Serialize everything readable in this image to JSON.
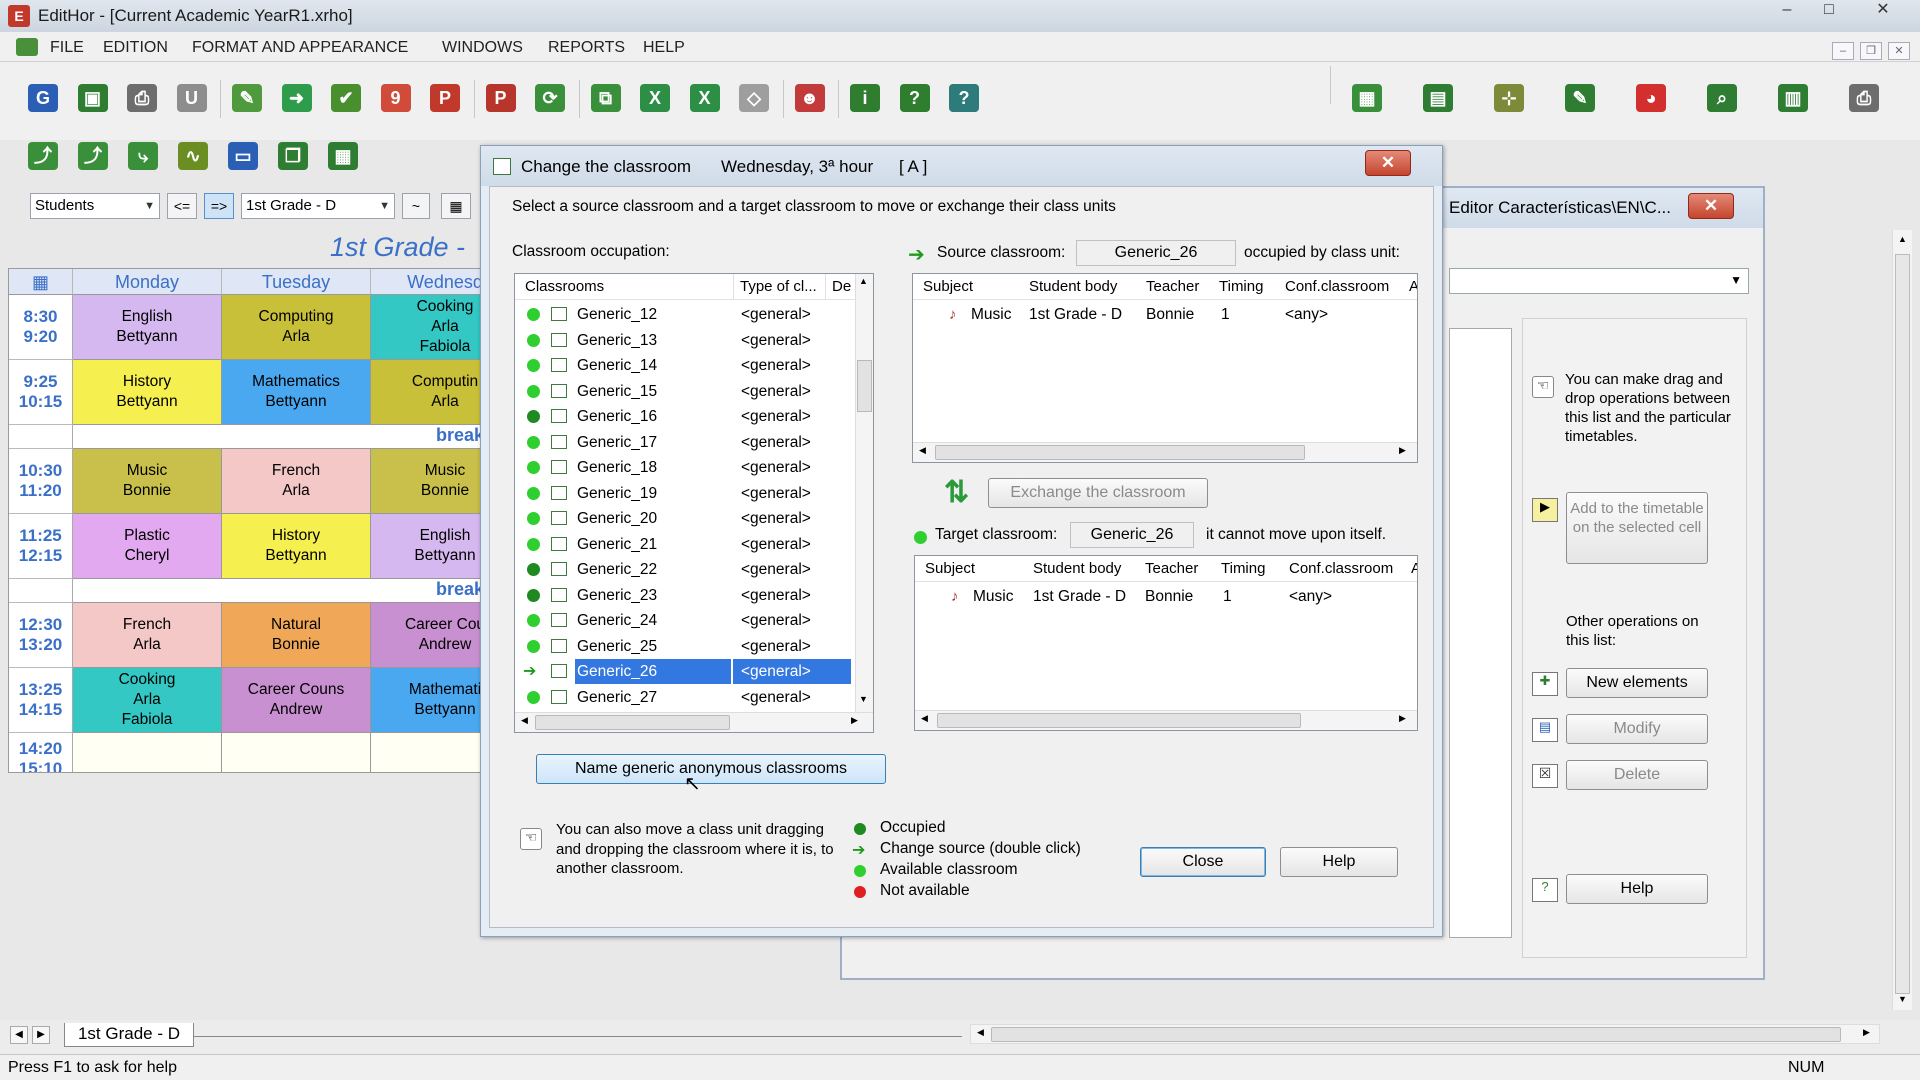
{
  "app": {
    "title": "EditHor - [Current Academic YearR1.xrho]",
    "window_controls": [
      "–",
      "□",
      "✕"
    ]
  },
  "menu": [
    "FILE",
    "EDITION",
    "FORMAT AND APPEARANCE",
    "WINDOWS",
    "REPORTS",
    "HELP"
  ],
  "toolbar": {
    "icons_row1": [
      {
        "name": "ghc-icon",
        "color": "#2a5fb5",
        "glyph": "G"
      },
      {
        "name": "save-icon",
        "color": "#2e7d32",
        "glyph": "▣"
      },
      {
        "name": "print-icon",
        "color": "#6d6d6d",
        "glyph": "⎙"
      },
      {
        "name": "attach-icon",
        "color": "#8d8d8d",
        "glyph": "U"
      },
      {
        "name": "chart-edit-icon",
        "color": "#4f9a3c",
        "glyph": "✎"
      },
      {
        "name": "export-icon",
        "color": "#2e9c4a",
        "glyph": "➜"
      },
      {
        "name": "check-icon",
        "color": "#4a8f2e",
        "glyph": "✔"
      },
      {
        "name": "calendar-icon",
        "color": "#d14b3b",
        "glyph": "9"
      },
      {
        "name": "pdf-icon",
        "color": "#c0392b",
        "glyph": "P"
      },
      {
        "name": "pdf2-icon",
        "color": "#b7352a",
        "glyph": "P"
      },
      {
        "name": "refresh-icon",
        "color": "#3a8f3a",
        "glyph": "⟳"
      },
      {
        "name": "copy-icon",
        "color": "#3a8f3a",
        "glyph": "⧉"
      },
      {
        "name": "excel-icon",
        "color": "#2d8f45",
        "glyph": "X"
      },
      {
        "name": "excel2-icon",
        "color": "#2d8f45",
        "glyph": "X"
      },
      {
        "name": "eraser-icon",
        "color": "#9e9e9e",
        "glyph": "◇"
      },
      {
        "name": "group-icon",
        "color": "#c23a3a",
        "glyph": "☻"
      },
      {
        "name": "info-icon",
        "color": "#2f7d2f",
        "glyph": "i"
      },
      {
        "name": "help-icon",
        "color": "#2f7d2f",
        "glyph": "?"
      },
      {
        "name": "whats-this-icon",
        "color": "#2d7b7b",
        "glyph": "?"
      }
    ],
    "icons_row1_right": [
      {
        "name": "grid-chart-icon",
        "color": "#3a8f3a",
        "glyph": "▦"
      },
      {
        "name": "layout-icon",
        "color": "#2e7d32",
        "glyph": "▤"
      },
      {
        "name": "tree-icon",
        "color": "#7c8a3a",
        "glyph": "⊹"
      },
      {
        "name": "pen-check-icon",
        "color": "#2e7d32",
        "glyph": "✎"
      },
      {
        "name": "palette-icon",
        "color": "#d32f2f",
        "glyph": "◕"
      },
      {
        "name": "zoom-icon",
        "color": "#2e7d32",
        "glyph": "⌕"
      },
      {
        "name": "table-icon",
        "color": "#2e7d32",
        "glyph": "▥"
      },
      {
        "name": "printer2-icon",
        "color": "#6d6d6d",
        "glyph": "⎙"
      }
    ],
    "icons_row2": [
      {
        "name": "move-up-icon",
        "color": "#3a8f3a",
        "glyph": "⤴"
      },
      {
        "name": "folder-up-icon",
        "color": "#3a8f3a",
        "glyph": "⤴"
      },
      {
        "name": "move-right-icon",
        "color": "#3a8f3a",
        "glyph": "⤷"
      },
      {
        "name": "wave-icon",
        "color": "#6b8e23",
        "glyph": "∿"
      },
      {
        "name": "monitor-icon",
        "color": "#2a5fb5",
        "glyph": "▭"
      },
      {
        "name": "copy2-icon",
        "color": "#2e7d32",
        "glyph": "❐"
      },
      {
        "name": "sheet-icon",
        "color": "#2e7d32",
        "glyph": "▦"
      }
    ]
  },
  "selector": {
    "view": "Students",
    "prev": "<=",
    "next": "=>",
    "group": "1st Grade - D",
    "tilde": "~"
  },
  "timetable": {
    "title": "1st Grade -",
    "days": [
      "Monday",
      "Tuesday",
      "Wednesd"
    ],
    "rows": [
      {
        "time": [
          "8:30",
          "9:20"
        ],
        "cells": [
          {
            "lines": [
              "English",
              "Bettyann"
            ],
            "bg": "#d6b8f0"
          },
          {
            "lines": [
              "Computing",
              "Arla"
            ],
            "bg": "#c9c03a"
          },
          {
            "lines": [
              "Cooking",
              "Arla",
              "Fabiola"
            ],
            "bg": "#33c8c4"
          }
        ]
      },
      {
        "time": [
          "9:25",
          "10:15"
        ],
        "cells": [
          {
            "lines": [
              "History",
              "Bettyann"
            ],
            "bg": "#f5f050"
          },
          {
            "lines": [
              "Mathematics",
              "Bettyann"
            ],
            "bg": "#4aa8f0"
          },
          {
            "lines": [
              "Computin",
              "Arla"
            ],
            "bg": "#c9c03a"
          }
        ]
      },
      {
        "break": "break"
      },
      {
        "time": [
          "10:30",
          "11:20"
        ],
        "cells": [
          {
            "lines": [
              "Music",
              "Bonnie"
            ],
            "bg": "#c8c04a"
          },
          {
            "lines": [
              "French",
              "Arla"
            ],
            "bg": "#f5c8c8"
          },
          {
            "lines": [
              "Music",
              "Bonnie"
            ],
            "bg": "#c8c04a"
          }
        ]
      },
      {
        "time": [
          "11:25",
          "12:15"
        ],
        "cells": [
          {
            "lines": [
              "Plastic",
              "Cheryl"
            ],
            "bg": "#e2a8f0"
          },
          {
            "lines": [
              "History",
              "Bettyann"
            ],
            "bg": "#f5f050"
          },
          {
            "lines": [
              "English",
              "Bettyann"
            ],
            "bg": "#d6b8f0"
          }
        ]
      },
      {
        "break": "break"
      },
      {
        "time": [
          "12:30",
          "13:20"
        ],
        "cells": [
          {
            "lines": [
              "French",
              "Arla"
            ],
            "bg": "#f5c8c8"
          },
          {
            "lines": [
              "Natural",
              "Bonnie"
            ],
            "bg": "#f0a858"
          },
          {
            "lines": [
              "Career Cou",
              "Andrew"
            ],
            "bg": "#c890d0"
          }
        ]
      },
      {
        "time": [
          "13:25",
          "14:15"
        ],
        "cells": [
          {
            "lines": [
              "Cooking",
              "Arla",
              "Fabiola"
            ],
            "bg": "#33c8c4"
          },
          {
            "lines": [
              "Career Couns",
              "Andrew"
            ],
            "bg": "#c890d0"
          },
          {
            "lines": [
              "Mathemati",
              "Bettyann"
            ],
            "bg": "#4aa8f0"
          }
        ]
      },
      {
        "time": [
          "14:20",
          "15:10"
        ],
        "cells": [
          {
            "lines": [],
            "bg": "#fffff4"
          },
          {
            "lines": [],
            "bg": "#fffff4"
          },
          {
            "lines": [],
            "bg": "#fffff4"
          }
        ]
      }
    ]
  },
  "bg_editor": {
    "title": "Editor Características\\EN\\C...",
    "hint": "You can make drag and drop operations between this list and the particular timetables.",
    "add_button": "Add to the timetable on the selected cell",
    "other_ops": "Other operations on this list:",
    "new_elements": "New elements",
    "modify": "Modify",
    "delete": "Delete",
    "help": "Help"
  },
  "dialog": {
    "title": "Change the classroom",
    "when": "Wednesday, 3ª hour",
    "tag": "[ A ]",
    "instruction": "Select a source classroom and a target classroom to move or exchange their class units",
    "occupation_label": "Classroom occupation:",
    "columns": [
      "Classrooms",
      "Type of cl...",
      "De"
    ],
    "classrooms": [
      {
        "name": "Generic_12",
        "type": "<general>",
        "status": "available"
      },
      {
        "name": "Generic_13",
        "type": "<general>",
        "status": "available"
      },
      {
        "name": "Generic_14",
        "type": "<general>",
        "status": "available"
      },
      {
        "name": "Generic_15",
        "type": "<general>",
        "status": "available"
      },
      {
        "name": "Generic_16",
        "type": "<general>",
        "status": "occupied"
      },
      {
        "name": "Generic_17",
        "type": "<general>",
        "status": "available"
      },
      {
        "name": "Generic_18",
        "type": "<general>",
        "status": "available"
      },
      {
        "name": "Generic_19",
        "type": "<general>",
        "status": "available"
      },
      {
        "name": "Generic_20",
        "type": "<general>",
        "status": "available"
      },
      {
        "name": "Generic_21",
        "type": "<general>",
        "status": "available"
      },
      {
        "name": "Generic_22",
        "type": "<general>",
        "status": "occupied"
      },
      {
        "name": "Generic_23",
        "type": "<general>",
        "status": "occupied"
      },
      {
        "name": "Generic_24",
        "type": "<general>",
        "status": "available"
      },
      {
        "name": "Generic_25",
        "type": "<general>",
        "status": "available"
      },
      {
        "name": "Generic_26",
        "type": "<general>",
        "status": "source",
        "selected": true
      },
      {
        "name": "Generic_27",
        "type": "<general>",
        "status": "available"
      }
    ],
    "source_label": "Source classroom:",
    "source_value": "Generic_26",
    "source_suffix": "occupied by class unit:",
    "unit_columns": [
      "Subject",
      "Student body",
      "Teacher",
      "Timing",
      "Conf.classroom",
      "A"
    ],
    "source_unit": {
      "subject": "Music",
      "body": "1st Grade - D",
      "teacher": "Bonnie",
      "timing": "1",
      "conf": "<any>"
    },
    "exchange_button": "Exchange the classroom",
    "target_label": "Target classroom:",
    "target_value": "Generic_26",
    "target_suffix": "it cannot move upon itself.",
    "target_unit": {
      "subject": "Music",
      "body": "1st Grade - D",
      "teacher": "Bonnie",
      "timing": "1",
      "conf": "<any>"
    },
    "name_generic_button": "Name generic anonymous classrooms",
    "tip": "You can also move a class unit dragging and dropping the classroom where it is, to another classroom.",
    "legend": [
      {
        "label": "Occupied",
        "kind": "dot",
        "color": "#1f8a1f"
      },
      {
        "label": "Change source (double click)",
        "kind": "arrow",
        "color": "#1f9a1f"
      },
      {
        "label": "Available classroom",
        "kind": "dot",
        "color": "#2fcf2f"
      },
      {
        "label": "Not available",
        "kind": "dot",
        "color": "#e02020"
      }
    ],
    "close_button": "Close",
    "help_button": "Help"
  },
  "tabs": {
    "sheet": "1st Grade - D"
  },
  "status": {
    "text": "Press F1 to ask for help",
    "num": "NUM"
  },
  "colors": {
    "selection": "#3378e0",
    "available": "#2fcf2f",
    "occupied": "#1f8a1f",
    "accent_blue": "#3a70c8"
  }
}
